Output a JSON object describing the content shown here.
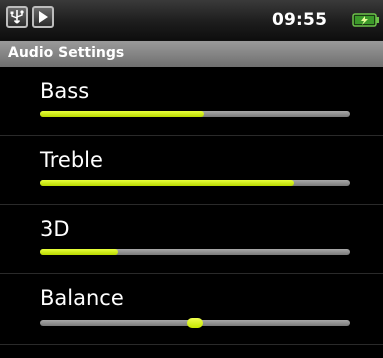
{
  "status_bar": {
    "icons": [
      "usb-icon",
      "play-icon",
      "battery-icon"
    ],
    "time": "09:55"
  },
  "header": {
    "title": "Audio Settings"
  },
  "settings": [
    {
      "label": "Bass",
      "level": 0.53
    },
    {
      "label": "Treble",
      "level": 0.82
    },
    {
      "label": "3D",
      "level": 0.25
    },
    {
      "label": "Balance",
      "level": 0.5
    }
  ],
  "colors": {
    "accent": "#d4f000",
    "track": "#8f8f8f",
    "title_bar": "#868686"
  }
}
